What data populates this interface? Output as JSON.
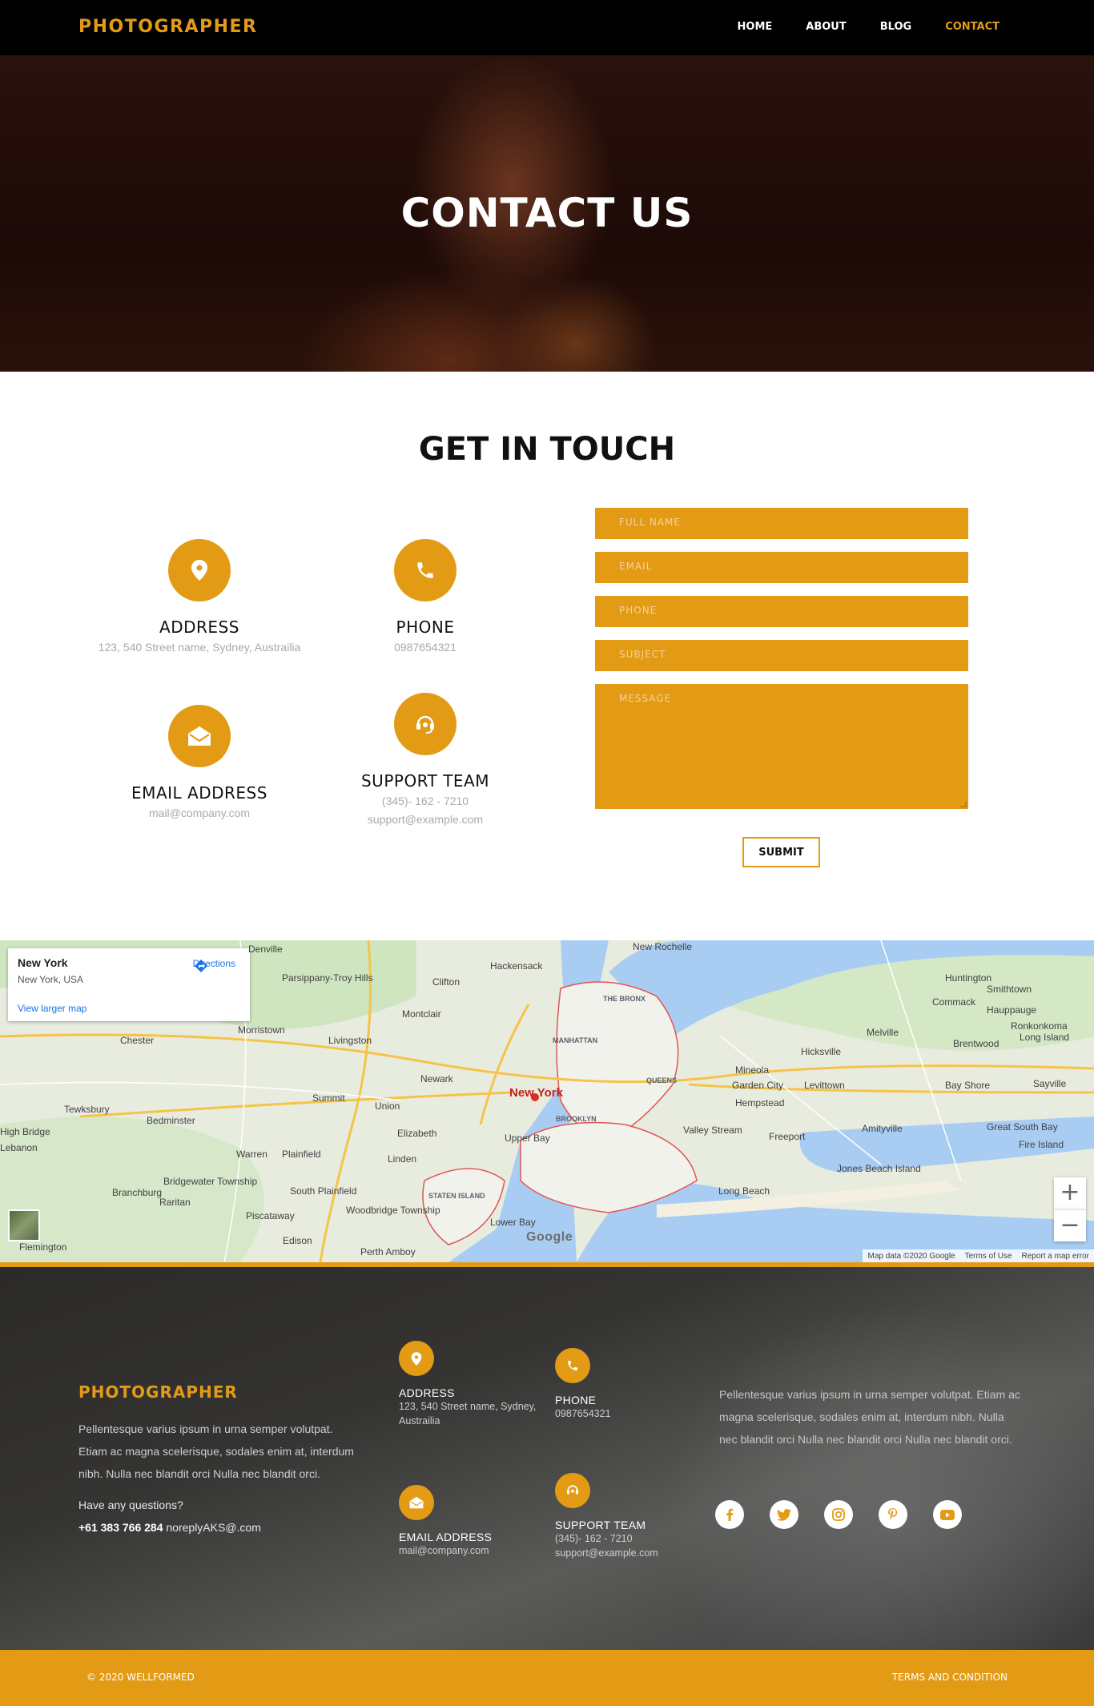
{
  "nav": {
    "brand": "PHOTOGRAPHER",
    "links": [
      "HOME",
      "ABOUT",
      "BLOG",
      "CONTACT"
    ],
    "active": "CONTACT"
  },
  "hero": {
    "title": "CONTACT US"
  },
  "touch": {
    "title": "GET IN TOUCH",
    "address": {
      "title": "ADDRESS",
      "line": "123, 540 Street name, Sydney, Austrailia"
    },
    "phone": {
      "title": "PHONE",
      "line": "0987654321"
    },
    "email": {
      "title": "EMAIL ADDRESS",
      "line": "mail@company.com"
    },
    "support": {
      "title": "SUPPORT TEAM",
      "phone": "(345)- 162 - 7210",
      "email": "support@example.com"
    }
  },
  "form": {
    "full_name": "FULL NAME",
    "email": "EMAIL",
    "phone": "PHONE",
    "subject": "SUBJECT",
    "message": "MESSAGE",
    "submit": "SUBMIT"
  },
  "map": {
    "place": "New York",
    "address": "New York, USA",
    "directions": "Directions",
    "larger": "View larger map",
    "marker_label": "New York",
    "google": "Google",
    "zoom_in": "+",
    "zoom_out": "−",
    "attrib": [
      "Map data ©2020 Google",
      "Terms of Use",
      "Report a map error"
    ],
    "labels": [
      "Clifton",
      "Hackensack",
      "New Rochelle",
      "Huntington",
      "Parsippany-Troy Hills",
      "Montclair",
      "THE BRONX",
      "Commack",
      "Smithtown",
      "Hauppauge",
      "Ronkonkoma",
      "Long Island",
      "Morristown",
      "Chester",
      "Livingston",
      "MANHATTAN",
      "Melville",
      "Brentwood",
      "Hicksville",
      "Newark",
      "QUEENS",
      "Mineola",
      "Garden City",
      "Levittown",
      "Bay Shore",
      "Sayville",
      "Tewksbury",
      "Summit",
      "Union",
      "Hempstead",
      "Bedminster",
      "BROOKLYN",
      "Elizabeth",
      "Valley Stream",
      "Freeport",
      "Amityville",
      "Great South Bay",
      "Fire Island",
      "Lebanon",
      "Warren",
      "Plainfield",
      "Linden",
      "Jones Beach Island",
      "Bridgewater Township",
      "Branchburg",
      "Raritan",
      "South Plainfield",
      "STATEN ISLAND",
      "Woodbridge Township",
      "Long Beach",
      "Piscataway",
      "Edison",
      "Perth Amboy",
      "Flemington",
      "Upper Bay",
      "Lower Bay",
      "Denville",
      "High Bridge"
    ]
  },
  "footer": {
    "brand": "PHOTOGRAPHER",
    "text": "Pellentesque varius ipsum in urna semper volutpat. Etiam ac magna scelerisque, sodales enim at, interdum nibh. Nulla nec blandit orci Nulla nec blandit orci.",
    "question": "Have any questions?",
    "phone": "+61 383 766 284",
    "email": "noreplyAKS@.com",
    "address": {
      "title": "ADDRESS",
      "line": "123, 540 Street name, Sydney, Austrailia"
    },
    "phone_block": {
      "title": "PHONE",
      "line": "0987654321"
    },
    "email_block": {
      "title": "EMAIL ADDRESS",
      "line": "mail@company.com"
    },
    "support": {
      "title": "SUPPORT TEAM",
      "phone": "(345)- 162 - 7210",
      "email": "support@example.com"
    },
    "right_text": "Pellentesque varius ipsum in urna semper volutpat. Etiam ac magna scelerisque, sodales enim at, interdum nibh. Nulla nec blandit orci Nulla nec blandit orci Nulla nec blandit orci.",
    "socials": [
      "facebook-icon",
      "twitter-icon",
      "instagram-icon",
      "pinterest-icon",
      "youtube-icon"
    ],
    "copyright": "© 2020 WELLFORMED",
    "terms": "TERMS AND CONDITION"
  },
  "colors": {
    "accent": "#e39b16",
    "nav_bg": "#000000"
  }
}
